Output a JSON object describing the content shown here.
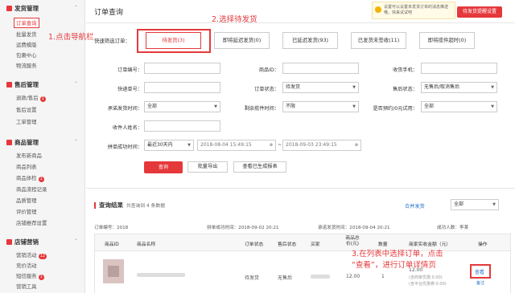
{
  "sidebar": {
    "sections": [
      {
        "title": "发货管理",
        "items": [
          "订单查询",
          "批量发货",
          "运费模版",
          "包裹中心",
          "物流服务"
        ]
      },
      {
        "title": "售后管理",
        "items": [
          "退款/售后",
          "售后设置",
          "工单管理"
        ],
        "badge": "1"
      },
      {
        "title": "商品管理",
        "items": [
          "发布新商品",
          "商品列表",
          "商品体检",
          "商品流程记录",
          "品质管理",
          "评价管理",
          "店铺推荐设置"
        ],
        "badge": "1"
      },
      {
        "title": "店铺营销",
        "items": [
          "营销活动",
          "竞价活动",
          "短信服务",
          "营销工具"
        ],
        "badges": [
          "12",
          "",
          "1",
          ""
        ]
      }
    ]
  },
  "annotations": {
    "step1": "1.点击导航栏",
    "step2": "2.选择待发货",
    "step3_line1": "3.在列表中选择订单，点击",
    "step3_line2": "“查看”，进行订单详情页"
  },
  "header": {
    "title": "订单查询",
    "notice": "设置可以设置未发货订单的消息推送哦，快来试试吧",
    "notice_button": "待发货提醒设置"
  },
  "filter": {
    "label": "快速筛选订单：",
    "tabs": [
      "待发货(3)",
      "即将延迟发货(0)",
      "已延迟发货(93)",
      "已发货未签收(11)",
      "即将揽件超时(0)"
    ]
  },
  "form": {
    "order_no": "订单编号：",
    "goods_id": "商品ID：",
    "receiver_phone": "收货手机：",
    "express_no": "快递单号：",
    "order_status": "订单状态：",
    "order_status_value": "待发货",
    "aftersale_status": "售后状态：",
    "aftersale_status_value": "无售后/取消售后",
    "promise_time": "承诺发货时间：",
    "promise_time_value": "全部",
    "remain_time": "剩余揽件时间：",
    "remain_time_value": "不限",
    "presale": "是否预约/0元试用：",
    "presale_value": "全部",
    "receiver_name": "收件人姓名：",
    "deal_time": "拼单成功时间：",
    "deal_time_value": "最近30天内",
    "date_from": "2018-08-04 15:49:15",
    "date_to": "2018-09-03 23:49:15",
    "date_sep": "~",
    "query_btn": "查询",
    "export_btn": "批量导出",
    "view_reports_btn": "查看已生成报表"
  },
  "results": {
    "title": "查询结果",
    "count": "共查询到 4 条数据",
    "merge_link": "合并发货",
    "select_value": "全部",
    "order_info": {
      "order_no": "订单编号：2018",
      "deal_time": "拼单成功时间：2018-09-02 20:21",
      "promise_time": "承诺发货时间：2018-09-04 20:21",
      "shop": "成功人数：李某"
    },
    "columns": [
      "商品ID",
      "商品名称",
      "订单状态",
      "售后状态",
      "买家",
      "商品总价(元)",
      "数量",
      "商家实收金额（元）",
      "操作"
    ],
    "row": {
      "order_status": "待发货",
      "aftersale_status": "无售后",
      "price": "12.00",
      "qty": "1",
      "amount": "12.00",
      "amount_note1": "(含商家优惠:0.00)",
      "amount_note2": "(含平台优惠券:0.00)",
      "view": "查看",
      "remark": "备注"
    }
  },
  "colors": {
    "accent": "#e5383b",
    "link": "#2672c9"
  }
}
